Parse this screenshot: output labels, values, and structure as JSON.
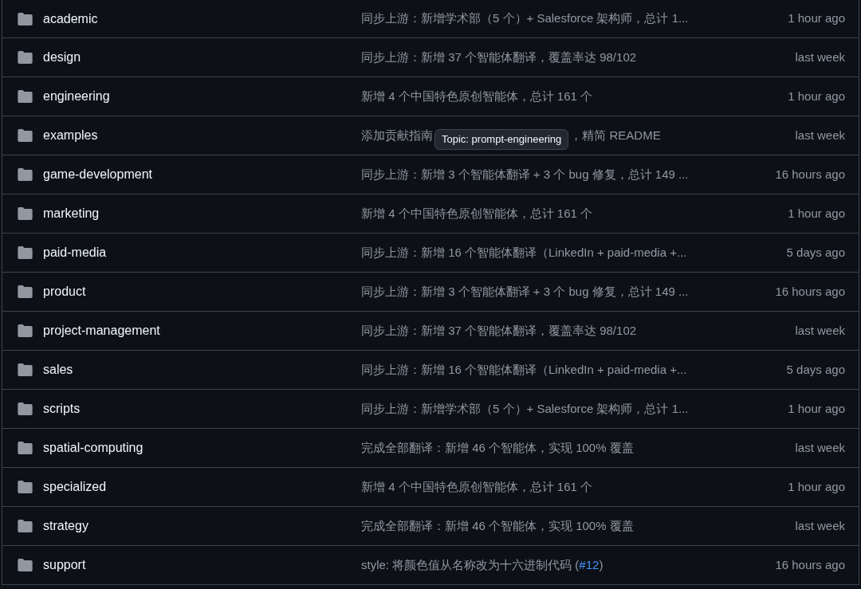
{
  "rows": [
    {
      "name": "academic",
      "message": "同步上游：新增学术部（5 个）+ Salesforce 架构师，总计 1...",
      "time": "1 hour ago"
    },
    {
      "name": "design",
      "message": "同步上游：新增 37 个智能体翻译，覆盖率达 98/102",
      "time": "last week"
    },
    {
      "name": "engineering",
      "message": "新增 4 个中国特色原创智能体，总计 161 个",
      "time": "1 hour ago"
    },
    {
      "name": "examples",
      "message": "添加贡献指南",
      "tooltip": "Topic: prompt-engineering",
      "message_after": "，精简 README",
      "time": "last week"
    },
    {
      "name": "game-development",
      "message": "同步上游：新增 3 个智能体翻译 + 3 个 bug 修复，总计 149 ...",
      "time": "16 hours ago"
    },
    {
      "name": "marketing",
      "message": "新增 4 个中国特色原创智能体，总计 161 个",
      "time": "1 hour ago"
    },
    {
      "name": "paid-media",
      "message": "同步上游：新增 16 个智能体翻译（LinkedIn + paid-media +...",
      "time": "5 days ago"
    },
    {
      "name": "product",
      "message": "同步上游：新增 3 个智能体翻译 + 3 个 bug 修复，总计 149 ...",
      "time": "16 hours ago"
    },
    {
      "name": "project-management",
      "message": "同步上游：新增 37 个智能体翻译，覆盖率达 98/102",
      "time": "last week"
    },
    {
      "name": "sales",
      "message": "同步上游：新增 16 个智能体翻译（LinkedIn + paid-media +...",
      "time": "5 days ago"
    },
    {
      "name": "scripts",
      "message": "同步上游：新增学术部（5 个）+ Salesforce 架构师，总计 1...",
      "time": "1 hour ago"
    },
    {
      "name": "spatial-computing",
      "message": "完成全部翻译：新增 46 个智能体，实现 100% 覆盖",
      "time": "last week"
    },
    {
      "name": "specialized",
      "message": "新增 4 个中国特色原创智能体，总计 161 个",
      "time": "1 hour ago"
    },
    {
      "name": "strategy",
      "message": "完成全部翻译：新增 46 个智能体，实现 100% 覆盖",
      "time": "last week"
    },
    {
      "name": "support",
      "message": "style: 将颜色值从名称改为十六进制代码 (",
      "link": "#12",
      "message_after": ")",
      "time": "16 hours ago"
    }
  ]
}
